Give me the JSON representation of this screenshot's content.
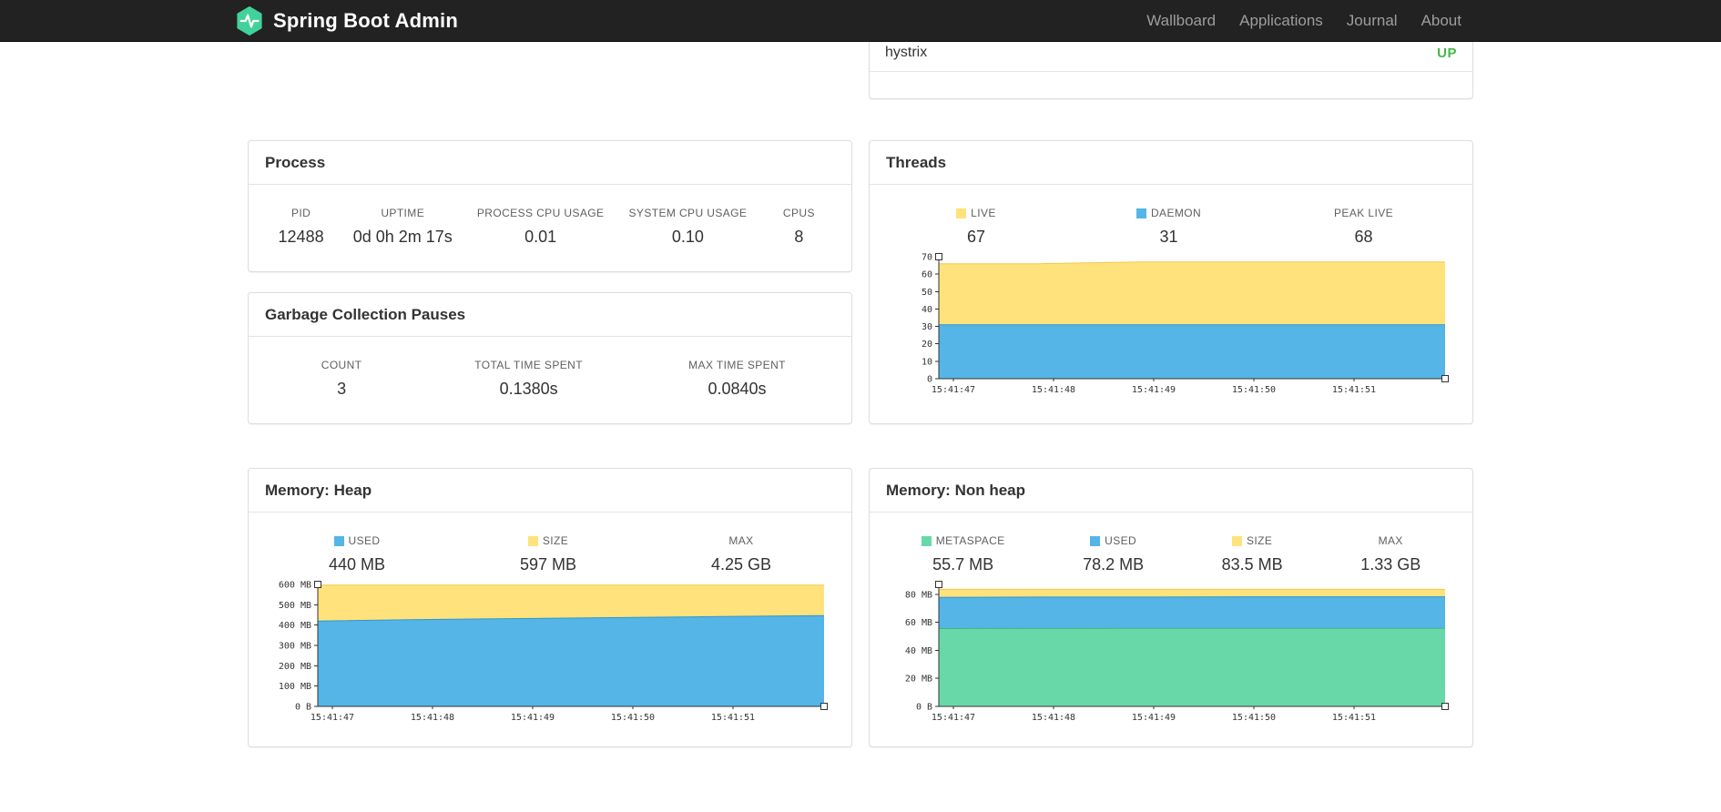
{
  "navbar": {
    "brand": "Spring Boot Admin",
    "links": [
      "Wallboard",
      "Applications",
      "Journal",
      "About"
    ]
  },
  "applications_panel": {
    "app_name": "hystrix",
    "status": "UP",
    "status_color": "#44b749"
  },
  "process_panel": {
    "title": "Process",
    "stats": [
      {
        "label": "PID",
        "value": "12488"
      },
      {
        "label": "UPTIME",
        "value": "0d 0h 2m 17s"
      },
      {
        "label": "PROCESS CPU USAGE",
        "value": "0.01"
      },
      {
        "label": "SYSTEM CPU USAGE",
        "value": "0.10"
      },
      {
        "label": "CPUS",
        "value": "8"
      }
    ]
  },
  "gc_panel": {
    "title": "Garbage Collection Pauses",
    "stats": [
      {
        "label": "COUNT",
        "value": "3"
      },
      {
        "label": "TOTAL TIME SPENT",
        "value": "0.1380s"
      },
      {
        "label": "MAX TIME SPENT",
        "value": "0.0840s"
      }
    ]
  },
  "threads_panel": {
    "title": "Threads",
    "stats": [
      {
        "label": "LIVE",
        "value": "67",
        "color": "#ffe27b"
      },
      {
        "label": "DAEMON",
        "value": "31",
        "color": "#55b5e6"
      },
      {
        "label": "PEAK LIVE",
        "value": "68"
      }
    ],
    "chart": {
      "type": "area",
      "ylim": [
        0,
        70
      ],
      "yticks": [
        {
          "v": 0,
          "label": "0"
        },
        {
          "v": 10,
          "label": "10"
        },
        {
          "v": 20,
          "label": "20"
        },
        {
          "v": 30,
          "label": "30"
        },
        {
          "v": 40,
          "label": "40"
        },
        {
          "v": 50,
          "label": "50"
        },
        {
          "v": 60,
          "label": "60"
        },
        {
          "v": 70,
          "label": "70"
        }
      ],
      "xlabels": [
        "15:41:47",
        "15:41:48",
        "15:41:49",
        "15:41:50",
        "15:41:51"
      ],
      "series": [
        {
          "name": "live",
          "color": "#ffe27b",
          "line": "#edc94f",
          "values": [
            66,
            66,
            67,
            67,
            67,
            67
          ]
        },
        {
          "name": "daemon",
          "color": "#55b5e6",
          "line": "#2f96cf",
          "values": [
            31,
            31,
            31,
            31,
            31,
            31
          ]
        }
      ]
    }
  },
  "heap_panel": {
    "title": "Memory: Heap",
    "stats": [
      {
        "label": "USED",
        "value": "440 MB",
        "color": "#55b5e6"
      },
      {
        "label": "SIZE",
        "value": "597 MB",
        "color": "#ffe27b"
      },
      {
        "label": "MAX",
        "value": "4.25 GB"
      }
    ],
    "chart": {
      "type": "area",
      "ylim": [
        0,
        600
      ],
      "yticks": [
        {
          "v": 0,
          "label": "0 B"
        },
        {
          "v": 100,
          "label": "100 MB"
        },
        {
          "v": 200,
          "label": "200 MB"
        },
        {
          "v": 300,
          "label": "300 MB"
        },
        {
          "v": 400,
          "label": "400 MB"
        },
        {
          "v": 500,
          "label": "500 MB"
        },
        {
          "v": 600,
          "label": "600 MB"
        }
      ],
      "xlabels": [
        "15:41:47",
        "15:41:48",
        "15:41:49",
        "15:41:50",
        "15:41:51"
      ],
      "series": [
        {
          "name": "size",
          "color": "#ffe27b",
          "line": "#edc94f",
          "values": [
            597,
            597,
            597,
            597,
            597,
            597
          ]
        },
        {
          "name": "used",
          "color": "#55b5e6",
          "line": "#2f96cf",
          "values": [
            420,
            427,
            432,
            437,
            442,
            447
          ]
        }
      ]
    }
  },
  "nonheap_panel": {
    "title": "Memory: Non heap",
    "stats": [
      {
        "label": "METASPACE",
        "value": "55.7 MB",
        "color": "#68d8a9"
      },
      {
        "label": "USED",
        "value": "78.2 MB",
        "color": "#55b5e6"
      },
      {
        "label": "SIZE",
        "value": "83.5 MB",
        "color": "#ffe27b"
      },
      {
        "label": "MAX",
        "value": "1.33 GB"
      }
    ],
    "chart": {
      "type": "area",
      "ylim": [
        0,
        87
      ],
      "yticks": [
        {
          "v": 0,
          "label": "0 B"
        },
        {
          "v": 20,
          "label": "20 MB"
        },
        {
          "v": 40,
          "label": "40 MB"
        },
        {
          "v": 60,
          "label": "60 MB"
        },
        {
          "v": 80,
          "label": "80 MB"
        }
      ],
      "xlabels": [
        "15:41:47",
        "15:41:48",
        "15:41:49",
        "15:41:50",
        "15:41:51"
      ],
      "series": [
        {
          "name": "size",
          "color": "#ffe27b",
          "line": "#edc94f",
          "values": [
            83.5,
            83.5,
            83.5,
            83.5,
            83.5,
            83.5
          ]
        },
        {
          "name": "used",
          "color": "#55b5e6",
          "line": "#2f96cf",
          "values": [
            77.8,
            78,
            78,
            78.2,
            78.2,
            78.2
          ]
        },
        {
          "name": "metaspace",
          "color": "#68d8a9",
          "line": "#3cba82",
          "values": [
            55.5,
            55.6,
            55.7,
            55.7,
            55.7,
            55.7
          ]
        }
      ]
    }
  }
}
